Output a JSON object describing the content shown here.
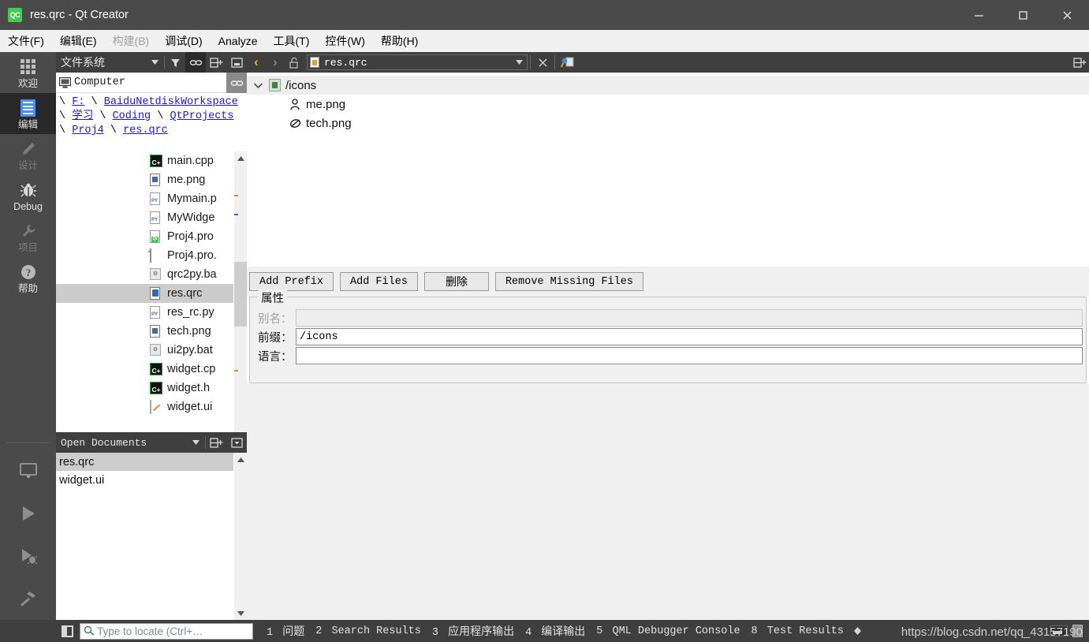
{
  "window": {
    "title": "res.qrc - Qt Creator",
    "logo_text": "QC",
    "minimize_label": "–",
    "maximize_label": "☐",
    "close_label": "✕"
  },
  "menubar": {
    "items": [
      {
        "label": "文件(F)",
        "disabled": false
      },
      {
        "label": "编辑(E)",
        "disabled": false
      },
      {
        "label": "构建(B)",
        "disabled": true
      },
      {
        "label": "调试(D)",
        "disabled": false
      },
      {
        "label": "Analyze",
        "disabled": false
      },
      {
        "label": "工具(T)",
        "disabled": false
      },
      {
        "label": "控件(W)",
        "disabled": false
      },
      {
        "label": "帮助(H)",
        "disabled": false
      }
    ]
  },
  "modebar": {
    "items": [
      {
        "label": "欢迎",
        "icon": "grid-icon",
        "state": "normal"
      },
      {
        "label": "编辑",
        "icon": "document-icon",
        "state": "selected"
      },
      {
        "label": "设计",
        "icon": "pencil-icon",
        "state": "disabled"
      },
      {
        "label": "Debug",
        "icon": "bug-icon",
        "state": "normal"
      },
      {
        "label": "项目",
        "icon": "wrench-icon",
        "state": "disabled"
      },
      {
        "label": "帮助",
        "icon": "question-icon",
        "state": "normal"
      }
    ],
    "bottom_buttons": [
      {
        "name": "kit-selector-icon",
        "tooltip": "monitor"
      },
      {
        "name": "run-icon",
        "tooltip": "play"
      },
      {
        "name": "debug-run-icon",
        "tooltip": "play-bug"
      },
      {
        "name": "build-icon",
        "tooltip": "hammer"
      }
    ]
  },
  "navigation": {
    "title": "文件系统",
    "toolbar_icons": [
      "filter-icon",
      "link-icon",
      "split-add-icon",
      "collapse-icon"
    ],
    "root": {
      "label": "Computer",
      "icon": "computer-icon"
    },
    "breadcrumb": {
      "segments": [
        "F:",
        "BaiduNetdiskWorkspace",
        "学习",
        "Coding",
        "QtProjects",
        "Proj4",
        "res.qrc"
      ],
      "separator": "\\"
    },
    "files": [
      {
        "name": "main.cpp",
        "icon": "cpp-file-icon",
        "selected": false
      },
      {
        "name": "me.png",
        "icon": "png-file-icon",
        "selected": false
      },
      {
        "name": "Mymain.p",
        "icon": "py-file-icon",
        "selected": false
      },
      {
        "name": "MyWidge",
        "icon": "py-file-icon",
        "selected": false
      },
      {
        "name": "Proj4.pro",
        "icon": "pro-file-icon",
        "selected": false
      },
      {
        "name": "Proj4.pro.",
        "icon": "plain-file-icon",
        "selected": false
      },
      {
        "name": "qrc2py.ba",
        "icon": "bat-file-icon",
        "selected": false
      },
      {
        "name": "res.qrc",
        "icon": "qrc-file-icon",
        "selected": true
      },
      {
        "name": "res_rc.py",
        "icon": "py-file-icon",
        "selected": false
      },
      {
        "name": "tech.png",
        "icon": "png-file-icon",
        "selected": false
      },
      {
        "name": "ui2py.bat",
        "icon": "bat-file-icon",
        "selected": false
      },
      {
        "name": "widget.cp",
        "icon": "cpp-file-icon",
        "selected": false
      },
      {
        "name": "widget.h",
        "icon": "h-file-icon",
        "selected": false
      },
      {
        "name": "widget.ui",
        "icon": "ui-file-icon",
        "selected": false
      }
    ]
  },
  "open_documents": {
    "title": "Open Documents",
    "toolbar_icons": [
      "split-add-icon",
      "collapse-icon"
    ],
    "items": [
      {
        "name": "res.qrc",
        "selected": true
      },
      {
        "name": "widget.ui",
        "selected": false
      }
    ]
  },
  "editor": {
    "toolbar": {
      "back_label": "‹",
      "forward_label": "›",
      "lock_icon": "unlock-icon",
      "file_icon": "qrc-file-icon",
      "filename": "res.qrc",
      "dropdown_arrow": "▼",
      "close_label": "✕",
      "split_icon": "split-add-icon",
      "right_split_icon": "split-add-icon"
    },
    "resource_tree": [
      {
        "label": "/icons",
        "level": 0,
        "icon": "prefix-folder-icon",
        "expanded": true,
        "caret": "⌄"
      },
      {
        "label": "me.png",
        "level": 1,
        "icon": "person-icon"
      },
      {
        "label": "tech.png",
        "level": 1,
        "icon": "swirl-icon"
      }
    ],
    "buttons": [
      {
        "label": "Add Prefix",
        "cjk": false
      },
      {
        "label": "Add Files",
        "cjk": false
      },
      {
        "label": "删除",
        "cjk": true
      },
      {
        "label": "Remove Missing Files",
        "cjk": false
      }
    ],
    "properties": {
      "group_title": "属性",
      "fields": [
        {
          "label": "别名：",
          "value": "",
          "disabled": true
        },
        {
          "label": "前缀：",
          "value": "/icons",
          "disabled": false
        },
        {
          "label": "语言：",
          "value": "",
          "disabled": false
        }
      ]
    }
  },
  "statusbar": {
    "sidebar_toggle_icon": "sidebar-toggle-icon",
    "locator": {
      "placeholder": "Type to locate (Ctrl+…",
      "icon": "search-icon",
      "value": ""
    },
    "panes": [
      {
        "number": "1",
        "label": "问题",
        "cjk": true
      },
      {
        "number": "2",
        "label": "Search Results",
        "cjk": false
      },
      {
        "number": "3",
        "label": "应用程序输出",
        "cjk": true
      },
      {
        "number": "4",
        "label": "编译输出",
        "cjk": true
      },
      {
        "number": "5",
        "label": "QML Debugger Console",
        "cjk": false
      },
      {
        "number": "8",
        "label": "Test Results",
        "cjk": false
      }
    ],
    "spinner_up": "▲",
    "spinner_down": "▼",
    "watermark": "https://blog.csdn.net/qq_43157190"
  },
  "colors": {
    "titlebar": "#4a4a4a",
    "modebar": "#4a4a4a",
    "mode_selected": "#282828",
    "panel_header": "#3f3f3f",
    "accent_blue": "#4a8ff7",
    "link": "#1919d0",
    "selection_grey": "#cccccc",
    "nav_back_active": "#e6b022",
    "qt_green": "#41cd52",
    "form_bg": "#f0f0f0"
  }
}
